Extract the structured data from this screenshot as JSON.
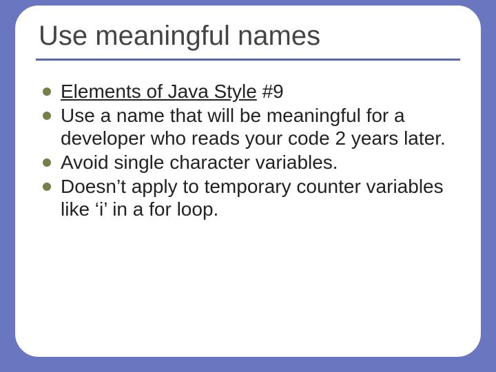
{
  "title": "Use meaningful names",
  "bullets": [
    {
      "prefix": "Elements of Java Style",
      "rest": " #9"
    },
    {
      "text": "Use a name that will be meaningful for a developer who reads your code 2 years later."
    },
    {
      "text": "Avoid single character variables."
    },
    {
      "text": "Doesn’t apply to temporary counter variables like ‘i’ in a for loop."
    }
  ]
}
